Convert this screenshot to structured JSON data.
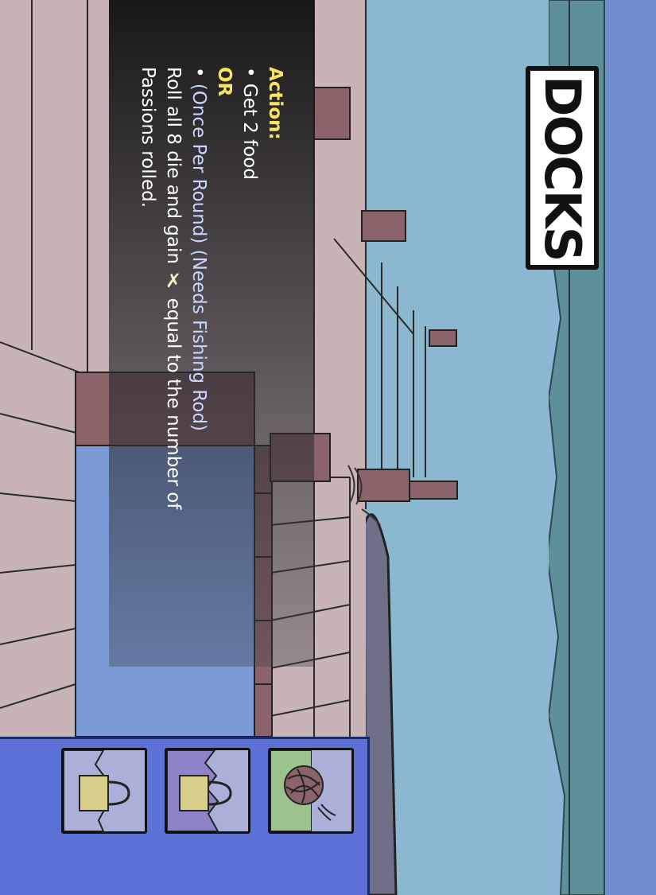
{
  "card": {
    "title": "DOCKS",
    "action_label": "Action:",
    "option1": "• Get 2 food",
    "or_label": "OR",
    "option2_prefix": "• ",
    "option2_condition": "(Once Per Round) (Needs Fishing Rod)",
    "option2_line1": "Roll all 8 die and gain",
    "option2_line2": "equal to the number of",
    "option2_line3": "Passions rolled.",
    "passion_icon": "x-star-icon"
  },
  "requirements": [
    {
      "name": "bag-icon",
      "accent": "#d8d08a"
    },
    {
      "name": "bag-icon",
      "accent": "#8e82c8"
    },
    {
      "name": "yarn-ball-icon",
      "accent": "#9cc28e"
    }
  ],
  "colors": {
    "sky": "#8db5d6",
    "water": "#6c9aa8",
    "dock": "#c9b3b4",
    "bar": "#5d72d6",
    "highlight": "#f7e45e"
  }
}
